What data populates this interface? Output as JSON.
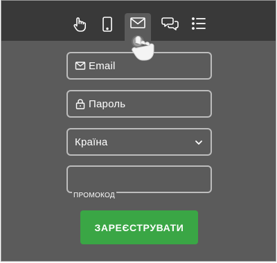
{
  "nav": {
    "tabs": [
      {
        "icon": "tap-hand-icon",
        "active": false
      },
      {
        "icon": "mobile-phone-icon",
        "active": false
      },
      {
        "icon": "envelope-icon",
        "active": true
      },
      {
        "icon": "chat-bubbles-icon",
        "active": false
      },
      {
        "icon": "list-icon",
        "active": false
      }
    ]
  },
  "form": {
    "email_placeholder": "Email",
    "password_placeholder": "Пароль",
    "country_value": "Країна",
    "promo_label": "ПРОМОКОД",
    "submit_label": "ЗАРЕЄСТРУВАТИ"
  },
  "colors": {
    "background": "#5b5b5b",
    "topbar": "#393939",
    "active_tab": "#5b5b5b",
    "field_border": "#bdbdbd",
    "button": "#3aa645",
    "text": "#ffffff"
  }
}
